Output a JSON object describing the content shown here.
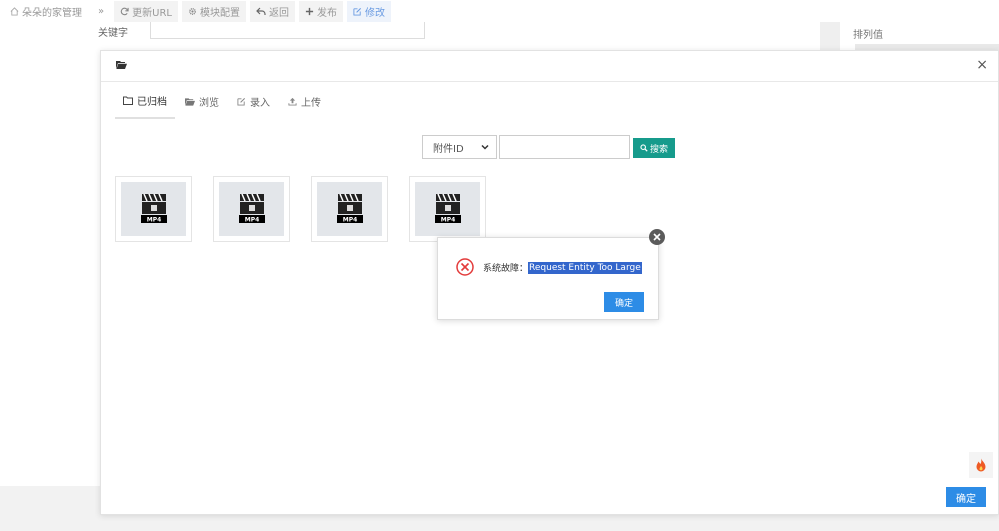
{
  "toolbar": {
    "items": [
      {
        "label": "朵朵的家管理",
        "icon": "home-icon"
      },
      {
        "label": "»",
        "icon": "double-chevron-icon"
      },
      {
        "label": "更新URL",
        "icon": "refresh-icon"
      },
      {
        "label": "模块配置",
        "icon": "gear-icon"
      },
      {
        "label": "返回",
        "icon": "reply-icon"
      },
      {
        "label": "发布",
        "icon": "plus-icon"
      },
      {
        "label": "修改",
        "icon": "edit-icon"
      }
    ]
  },
  "background": {
    "keyword_label": "关键字",
    "sort_label": "排列值"
  },
  "dialog": {
    "close": "×",
    "tabs": [
      {
        "label": "已归档",
        "icon": "folder-outline-icon"
      },
      {
        "label": "浏览",
        "icon": "folder-open-icon"
      },
      {
        "label": "录入",
        "icon": "edit-icon"
      },
      {
        "label": "上传",
        "icon": "upload-icon"
      }
    ],
    "search": {
      "field_option": "附件ID",
      "input_value": "",
      "button_label": "搜索"
    },
    "thumbnails": [
      {
        "badge": "MP4"
      },
      {
        "badge": "MP4"
      },
      {
        "badge": "MP4"
      },
      {
        "badge": "MP4"
      }
    ],
    "confirm_label": "确定"
  },
  "alert": {
    "prefix": "系统故障：",
    "message": "Request Entity Too Large",
    "ok_label": "确定"
  },
  "colors": {
    "search_button": "#169b8c",
    "primary_button": "#2d8ce6",
    "error_red": "#e33b3b",
    "selection": "#3366cc"
  }
}
